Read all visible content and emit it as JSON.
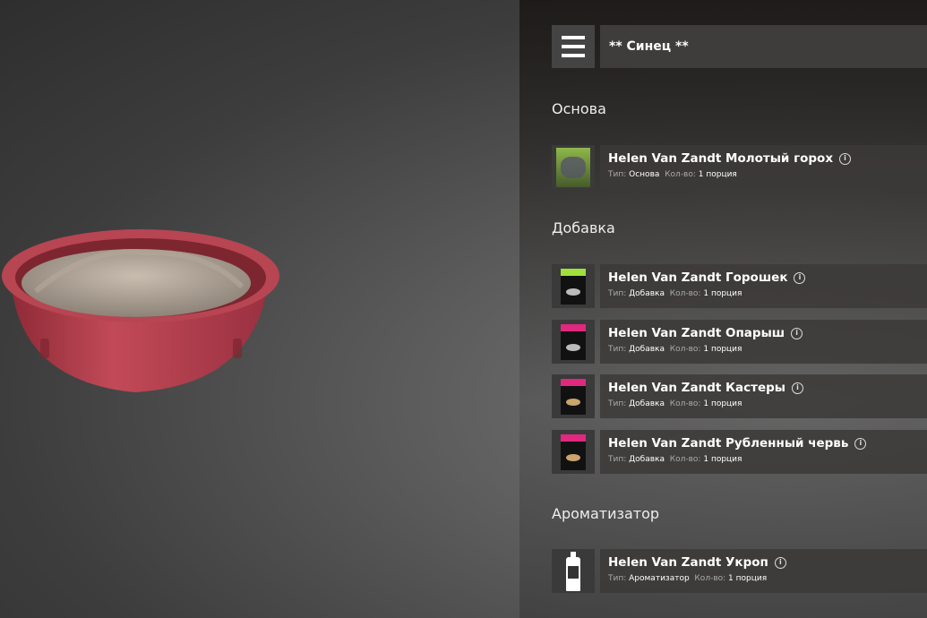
{
  "header": {
    "title": "** Синец **"
  },
  "sections": {
    "base": {
      "title": "Основа"
    },
    "additive": {
      "title": "Добавка"
    },
    "flavor": {
      "title": "Ароматизатор"
    }
  },
  "labels": {
    "type": "Тип:",
    "qty": "Кол-во:"
  },
  "items": [
    {
      "name": "Helen Van Zandt Молотый горох",
      "type": "Основа",
      "qty": "1 порция"
    },
    {
      "name": "Helen Van Zandt Горошек",
      "type": "Добавка",
      "qty": "1 порция"
    },
    {
      "name": "Helen Van Zandt Опарыш",
      "type": "Добавка",
      "qty": "1 порция"
    },
    {
      "name": "Helen Van Zandt Кастеры",
      "type": "Добавка",
      "qty": "1 порция"
    },
    {
      "name": "Helen Van Zandt Рубленный червь",
      "type": "Добавка",
      "qty": "1 порция"
    },
    {
      "name": "Helen Van Zandt Укроп",
      "type": "Ароматизатор",
      "qty": "1 порция"
    }
  ],
  "colors": {
    "bowl": "#b8404f",
    "pack_green": "#9fe03a",
    "pack_pink": "#e0287f"
  }
}
